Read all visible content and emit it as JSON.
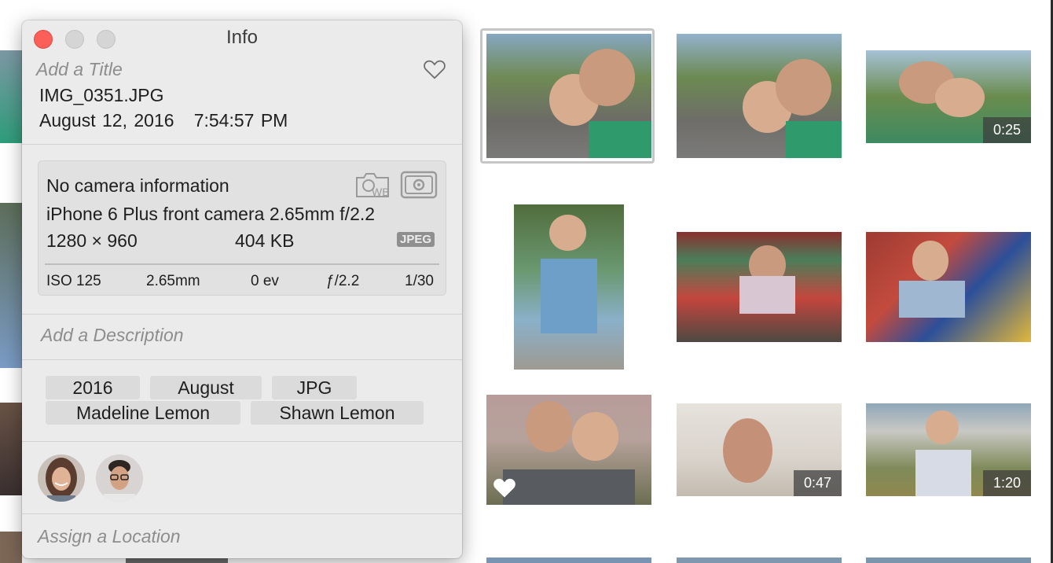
{
  "window": {
    "title": "Info"
  },
  "photo": {
    "title_placeholder": "Add a Title",
    "filename": "IMG_0351.JPG",
    "date": "August 12, 2016",
    "time": "7:54:57 PM"
  },
  "camera": {
    "info": "No camera information",
    "lens": "iPhone 6 Plus front camera 2.65mm f/2.2",
    "dimensions": "1280 × 960",
    "filesize": "404 KB",
    "format_badge": "JPEG",
    "exif": {
      "iso": "ISO 125",
      "focal_length": "2.65mm",
      "exposure_bias": "0 ev",
      "aperture": "ƒ/2.2",
      "shutter": "1/30"
    }
  },
  "description_placeholder": "Add a Description",
  "keywords": [
    "2016",
    "August",
    "JPG",
    "Madeline Lemon",
    "Shawn Lemon"
  ],
  "location_placeholder": "Assign a Location",
  "video_durations": [
    "0:25",
    "0:47",
    "1:20"
  ],
  "icons": [
    "heart-outline-icon",
    "white-balance-icon",
    "metering-icon",
    "heart-filled-icon"
  ],
  "colors": {
    "close": "#fc5f57",
    "panel": "#ecebeb",
    "keyword_bg": "#dcdbdb"
  }
}
